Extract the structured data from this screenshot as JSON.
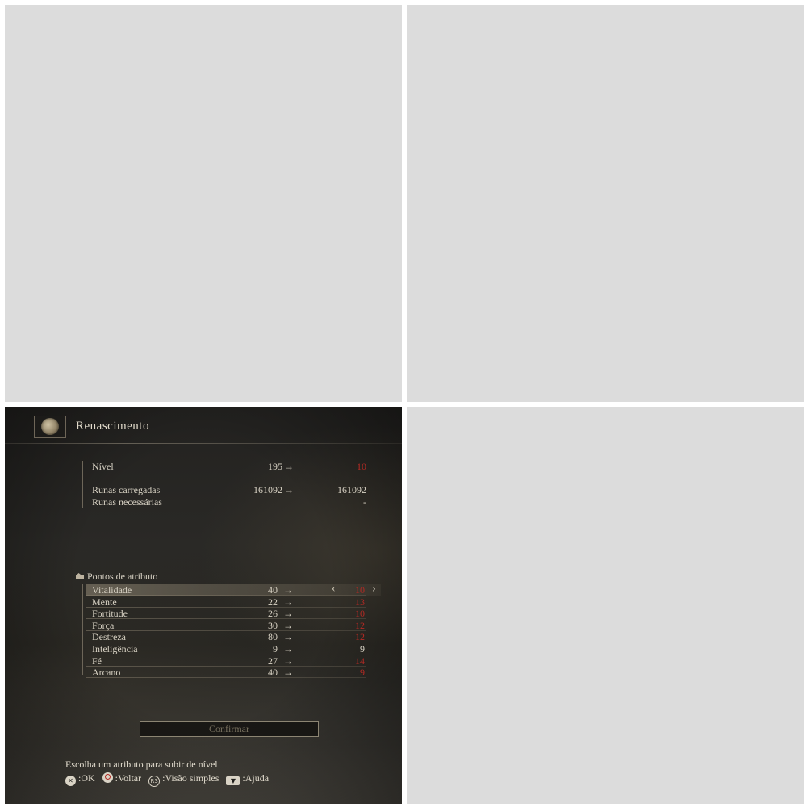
{
  "screen": {
    "title": "Renascimento"
  },
  "level": {
    "label": "Nível",
    "current": "195",
    "new": "10"
  },
  "runes": {
    "held_label": "Runas carregadas",
    "held_current": "161092",
    "held_new": "161092",
    "needed_label": "Runas necessárias",
    "needed_new": "-"
  },
  "attributes": {
    "heading": "Pontos de atributo",
    "items": [
      {
        "label": "Vitalidade",
        "current": "40",
        "new": "10",
        "color": "red",
        "selected": true
      },
      {
        "label": "Mente",
        "current": "22",
        "new": "13",
        "color": "red"
      },
      {
        "label": "Fortitude",
        "current": "26",
        "new": "10",
        "color": "red"
      },
      {
        "label": "Força",
        "current": "30",
        "new": "12",
        "color": "red"
      },
      {
        "label": "Destreza",
        "current": "80",
        "new": "12",
        "color": "red"
      },
      {
        "label": "Inteligência",
        "current": "9",
        "new": "9",
        "color": "white"
      },
      {
        "label": "Fé",
        "current": "27",
        "new": "14",
        "color": "red"
      },
      {
        "label": "Arcano",
        "current": "40",
        "new": "9",
        "color": "red"
      }
    ]
  },
  "arrow_glyph": "→",
  "confirm_label": "Confirmar",
  "hint": "Escolha um atributo para subir de nível",
  "controls": [
    {
      "glyph": "✕",
      "label": ":OK"
    },
    {
      "glyph": "",
      "label": ":Voltar"
    },
    {
      "glyph": "R3",
      "label": ":Visão simples"
    },
    {
      "glyph": "▼",
      "label": ":Ajuda"
    }
  ],
  "colors": {
    "accent_red": "#b32a24",
    "text": "#d8d2c4",
    "empty_tile": "#dcdcdc"
  }
}
